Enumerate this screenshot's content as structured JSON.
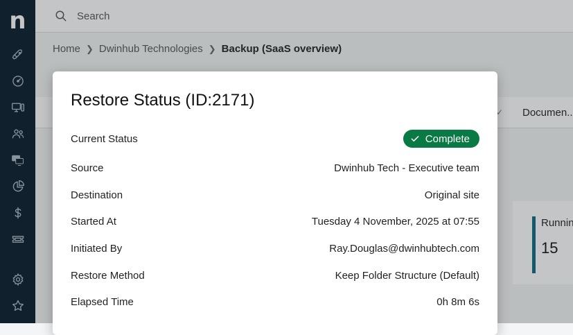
{
  "app": {
    "logo_letter": "n"
  },
  "sidebar": {
    "items": [
      {
        "icon": "rocket-icon"
      },
      {
        "icon": "dashboard-icon"
      },
      {
        "icon": "devices-icon"
      },
      {
        "icon": "users-icon"
      },
      {
        "icon": "monitors-icon"
      },
      {
        "icon": "pie-chart-icon"
      },
      {
        "icon": "dollar-icon"
      },
      {
        "icon": "ticket-icon"
      }
    ],
    "bottom_items": [
      {
        "icon": "gear-icon"
      },
      {
        "icon": "star-icon"
      }
    ]
  },
  "search": {
    "placeholder": "Search"
  },
  "breadcrumb": {
    "items": [
      "Home",
      "Dwinhub Technologies"
    ],
    "current": "Backup (SaaS overview)"
  },
  "background": {
    "tab_label": "Documen..",
    "card_label": "Runnin",
    "card_count": "15"
  },
  "modal": {
    "title": "Restore Status (ID:2171)",
    "rows": [
      {
        "label": "Current Status",
        "value": "Complete"
      },
      {
        "label": "Source",
        "value": "Dwinhub Tech - Executive team"
      },
      {
        "label": "Destination",
        "value": "Original site"
      },
      {
        "label": "Started At",
        "value": "Tuesday 4 November, 2025 at 07:55"
      },
      {
        "label": "Initiated By",
        "value": "Ray.Douglas@dwinhubtech.com"
      },
      {
        "label": "Restore Method",
        "value": "Keep Folder Structure (Default)"
      },
      {
        "label": "Elapsed Time",
        "value": "0h 8m 6s"
      }
    ]
  },
  "colors": {
    "sidebar_bg": "#071b2b",
    "status_complete": "#0a7a45",
    "accent": "#0c6b87"
  }
}
